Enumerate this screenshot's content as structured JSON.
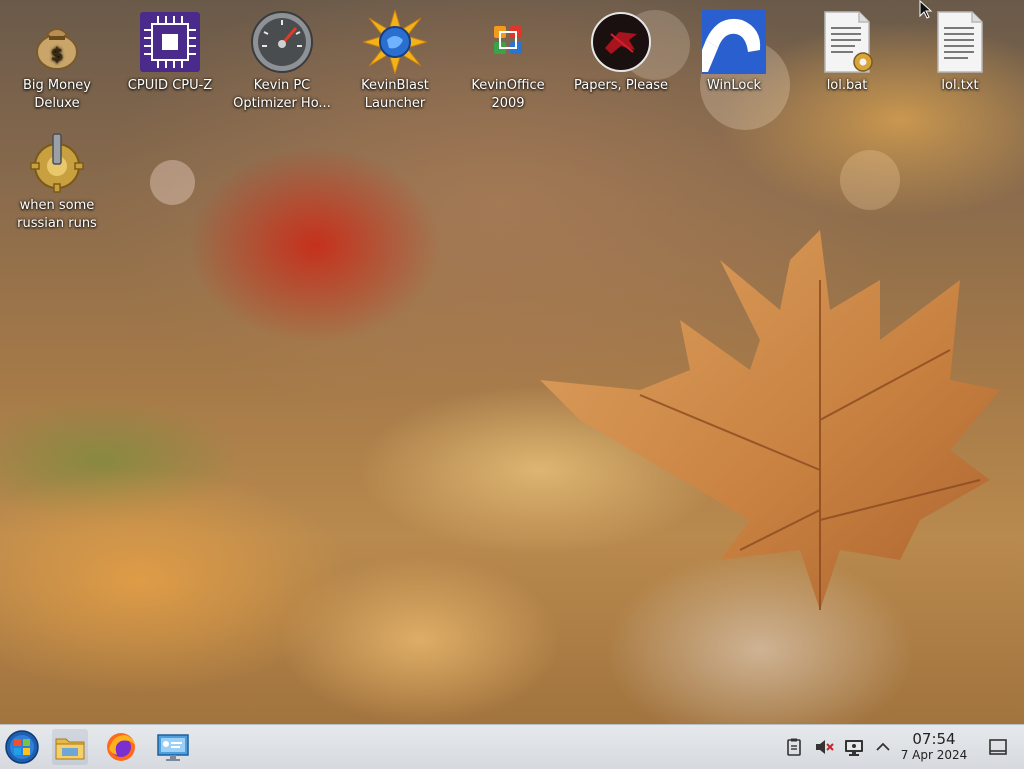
{
  "desktop": {
    "icons": [
      {
        "label": "Big Money Deluxe",
        "icon": "money-bag-icon"
      },
      {
        "label": "CPUID CPU-Z",
        "icon": "cpu-chip-icon"
      },
      {
        "label": "Kevin PC Optimizer Ho...",
        "icon": "speedometer-icon"
      },
      {
        "label": "KevinBlast Launcher",
        "icon": "sunburst-globe-icon"
      },
      {
        "label": "KevinOffice 2009",
        "icon": "office-logo-icon"
      },
      {
        "label": "Papers, Please",
        "icon": "papers-please-emblem-icon"
      },
      {
        "label": "WinLock",
        "icon": "winlock-icon"
      },
      {
        "label": "lol.bat",
        "icon": "batch-file-icon"
      },
      {
        "label": "lol.txt",
        "icon": "text-file-icon"
      },
      {
        "label": "when some russian runs a...",
        "icon": "gear-script-icon"
      }
    ]
  },
  "taskbar": {
    "start": {
      "icon": "start-orb-icon"
    },
    "pinned": [
      {
        "name": "file-manager",
        "icon": "folder-icon"
      },
      {
        "name": "firefox",
        "icon": "firefox-icon"
      },
      {
        "name": "system-settings",
        "icon": "monitor-settings-icon"
      }
    ],
    "tray": [
      {
        "name": "clipboard",
        "icon": "clipboard-icon"
      },
      {
        "name": "volume",
        "icon": "speaker-muted-icon"
      },
      {
        "name": "network",
        "icon": "network-monitor-icon"
      },
      {
        "name": "show-hidden",
        "icon": "chevron-up-icon"
      }
    ],
    "clock": {
      "time": "07:54",
      "date": "7 Apr 2024"
    },
    "show_desktop": {
      "icon": "show-desktop-icon"
    }
  },
  "colors": {
    "taskbar_bg": "#dde1e5",
    "label_text": "#ffffff",
    "clock_text": "#222222"
  }
}
